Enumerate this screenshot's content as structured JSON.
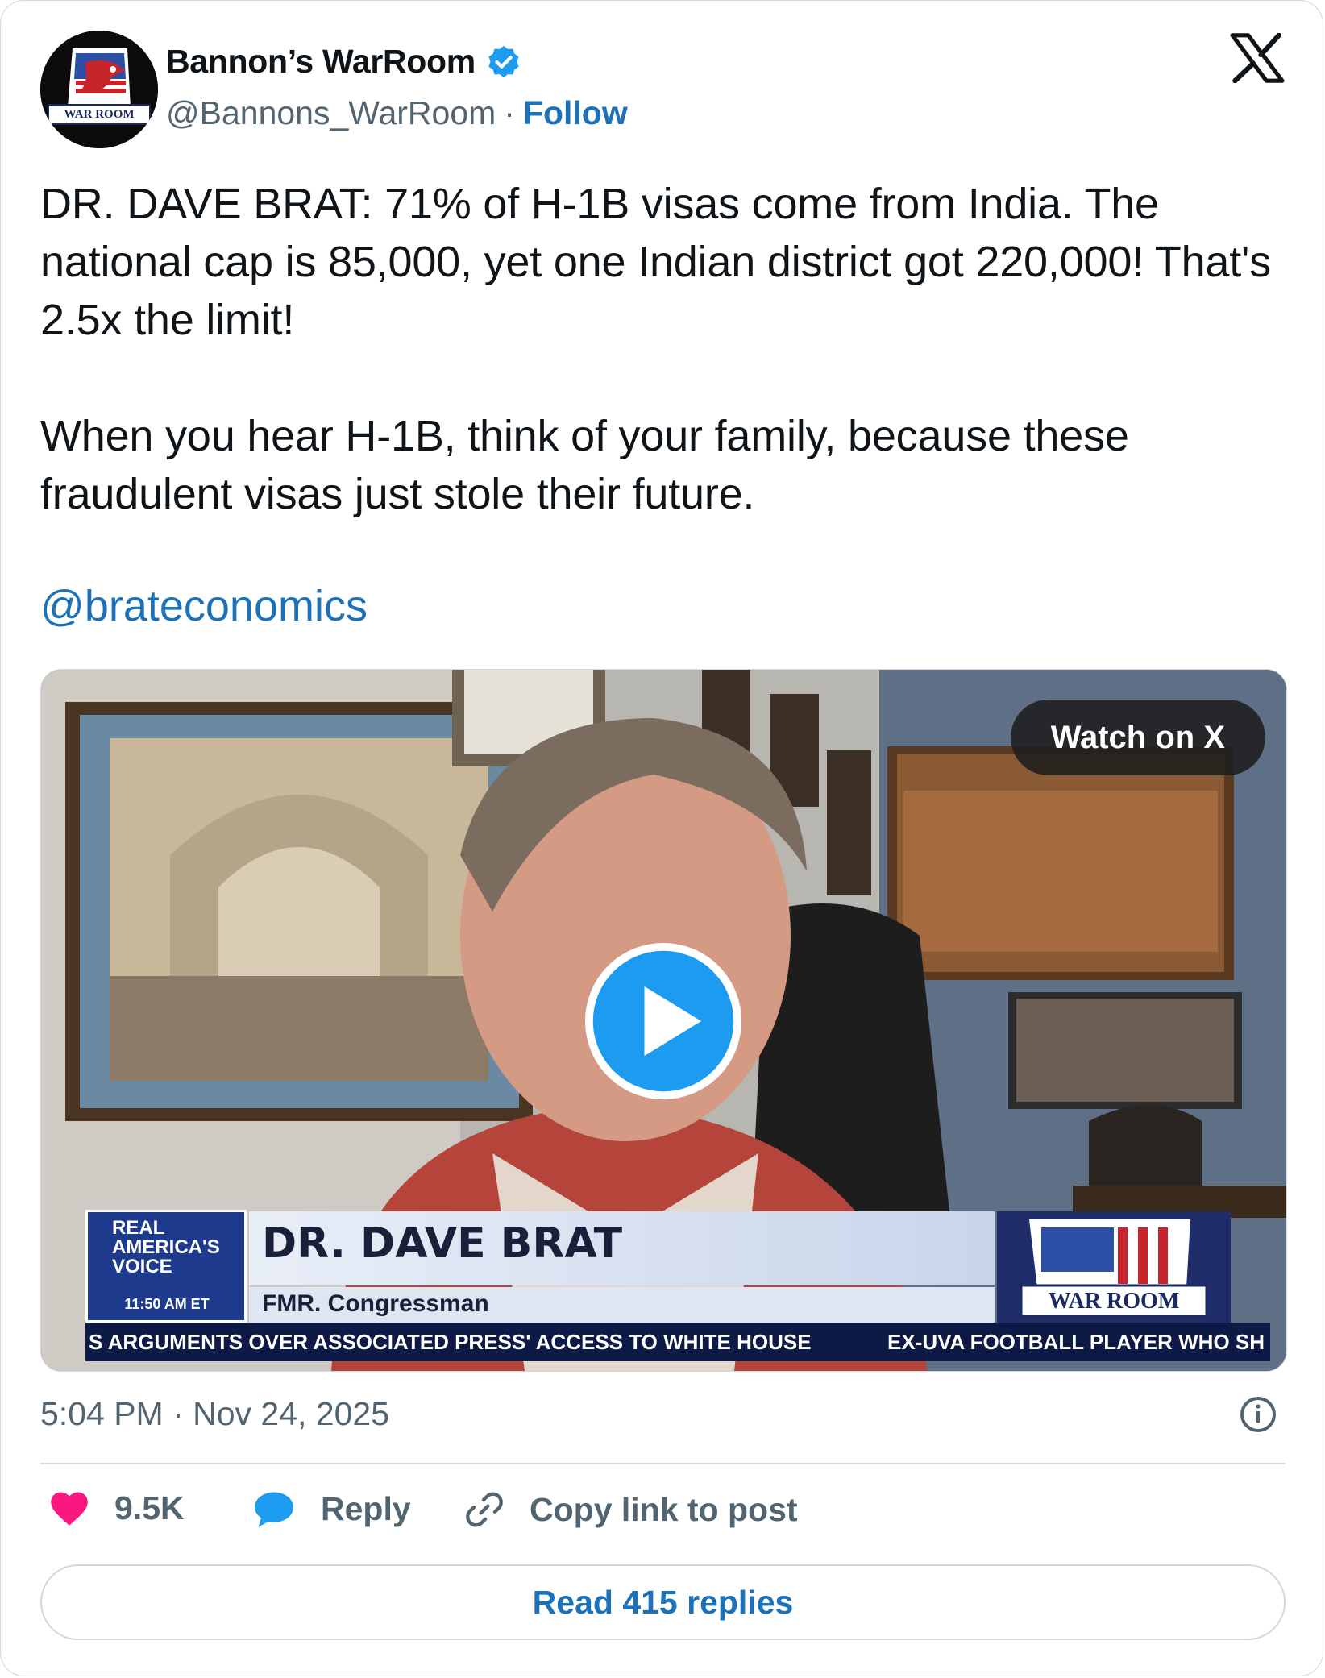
{
  "author": {
    "name": "Bannon’s WarRoom",
    "handle": "@Bannons_WarRoom",
    "separator": "·",
    "follow_label": "Follow",
    "avatar_text": "WAR ROOM"
  },
  "tweet": {
    "text": "DR. DAVE BRAT: 71% of H-1B visas come from India. The national cap is 85,000, yet one Indian district got 220,000! That's 2.5x the limit!\n\nWhen you hear H-1B, think of your family, because these fraudulent visas just stole their future.",
    "mention": "@brateconomics"
  },
  "media": {
    "watch_label": "Watch on X",
    "lower_third": {
      "network_line1": "REAL",
      "network_line2": "AMERICA'S",
      "network_line3": "VOICE",
      "time": "11:50 AM ET",
      "guest_name": "DR. DAVE BRAT",
      "guest_title": "FMR. Congressman",
      "show_logo": "WAR ROOM",
      "ticker_1": "S ARGUMENTS OVER ASSOCIATED PRESS' ACCESS TO WHITE HOUSE",
      "ticker_2": "EX-UVA FOOTBALL PLAYER WHO SH"
    }
  },
  "footer": {
    "timestamp": "5:04 PM · Nov 24, 2025",
    "likes": "9.5K",
    "reply_label": "Reply",
    "copy_label": "Copy link to post",
    "read_replies": "Read 415 replies"
  },
  "colors": {
    "link": "#1d71b8",
    "like": "#f91880",
    "reply": "#1d9bf0",
    "muted": "#536471"
  }
}
